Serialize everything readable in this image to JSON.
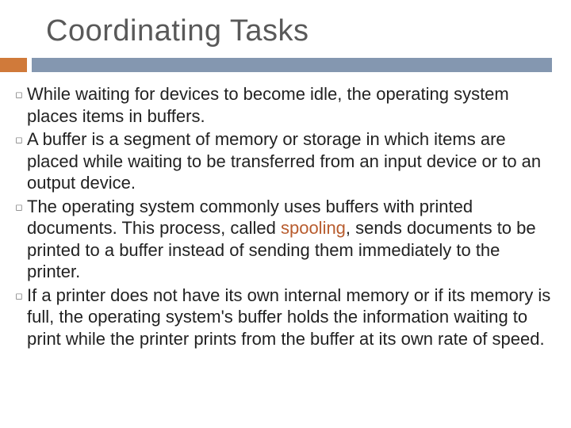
{
  "title": "Coordinating Tasks",
  "bullets": [
    {
      "text": "While waiting for devices to become idle, the operating system places items in buffers."
    },
    {
      "text": "A buffer is a segment of memory or storage in which items are placed while waiting to be transferred from an input device or to an output device."
    },
    {
      "pre": "The operating system commonly uses buffers with printed documents. This process, called ",
      "hl": "spooling",
      "post": ", sends documents to be printed to a buffer instead of sending them immediately to the printer."
    },
    {
      "text": "If a printer does not have its own internal memory or if its memory is full, the operating system's buffer holds the information waiting to print while the printer prints from the buffer at its own rate of speed."
    }
  ]
}
